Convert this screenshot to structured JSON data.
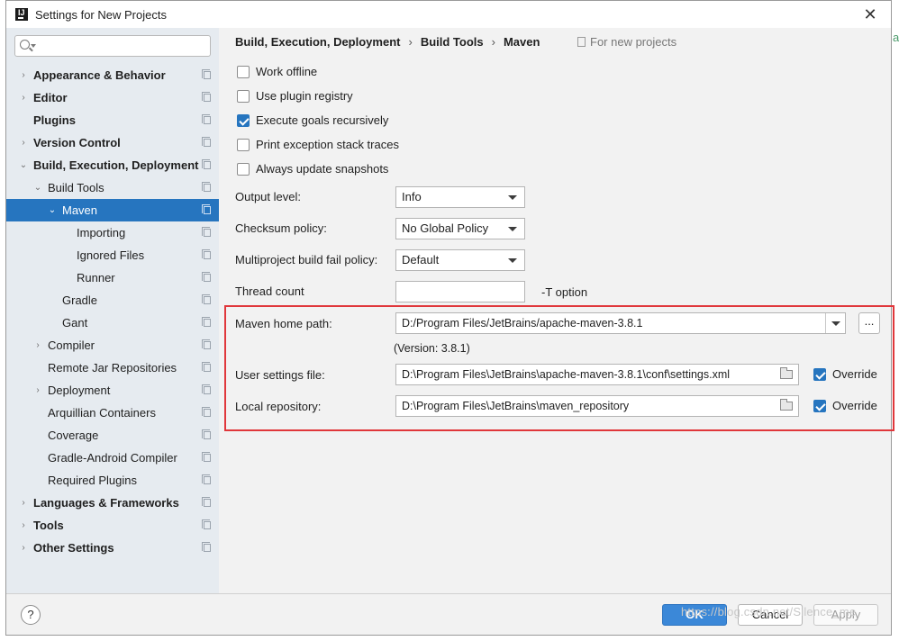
{
  "window": {
    "title": "Settings for New Projects",
    "app_icon_text": "IJ"
  },
  "sidebar": {
    "search_placeholder": "",
    "items": [
      {
        "label": "Appearance & Behavior",
        "level": 0,
        "bold": true,
        "arrow": "›",
        "selected": false
      },
      {
        "label": "Editor",
        "level": 0,
        "bold": true,
        "arrow": "›",
        "selected": false
      },
      {
        "label": "Plugins",
        "level": 0,
        "bold": true,
        "arrow": "",
        "selected": false
      },
      {
        "label": "Version Control",
        "level": 0,
        "bold": true,
        "arrow": "›",
        "selected": false
      },
      {
        "label": "Build, Execution, Deployment",
        "level": 0,
        "bold": true,
        "arrow": "⌄",
        "selected": false
      },
      {
        "label": "Build Tools",
        "level": 1,
        "bold": false,
        "arrow": "⌄",
        "selected": false
      },
      {
        "label": "Maven",
        "level": 2,
        "bold": false,
        "arrow": "⌄",
        "selected": true
      },
      {
        "label": "Importing",
        "level": 3,
        "bold": false,
        "arrow": "",
        "selected": false
      },
      {
        "label": "Ignored Files",
        "level": 3,
        "bold": false,
        "arrow": "",
        "selected": false
      },
      {
        "label": "Runner",
        "level": 3,
        "bold": false,
        "arrow": "",
        "selected": false
      },
      {
        "label": "Gradle",
        "level": 2,
        "bold": false,
        "arrow": "",
        "selected": false
      },
      {
        "label": "Gant",
        "level": 2,
        "bold": false,
        "arrow": "",
        "selected": false
      },
      {
        "label": "Compiler",
        "level": 1,
        "bold": false,
        "arrow": "›",
        "selected": false
      },
      {
        "label": "Remote Jar Repositories",
        "level": 1,
        "bold": false,
        "arrow": "",
        "selected": false
      },
      {
        "label": "Deployment",
        "level": 1,
        "bold": false,
        "arrow": "›",
        "selected": false
      },
      {
        "label": "Arquillian Containers",
        "level": 1,
        "bold": false,
        "arrow": "",
        "selected": false
      },
      {
        "label": "Coverage",
        "level": 1,
        "bold": false,
        "arrow": "",
        "selected": false
      },
      {
        "label": "Gradle-Android Compiler",
        "level": 1,
        "bold": false,
        "arrow": "",
        "selected": false
      },
      {
        "label": "Required Plugins",
        "level": 1,
        "bold": false,
        "arrow": "",
        "selected": false
      },
      {
        "label": "Languages & Frameworks",
        "level": 0,
        "bold": true,
        "arrow": "›",
        "selected": false
      },
      {
        "label": "Tools",
        "level": 0,
        "bold": true,
        "arrow": "›",
        "selected": false
      },
      {
        "label": "Other Settings",
        "level": 0,
        "bold": true,
        "arrow": "›",
        "selected": false
      }
    ]
  },
  "breadcrumb": {
    "items": [
      "Build, Execution, Deployment",
      "Build Tools",
      "Maven"
    ],
    "separator": "›",
    "scope_note": "For new projects"
  },
  "checkboxes": [
    {
      "label": "Work offline",
      "checked": false
    },
    {
      "label": "Use plugin registry",
      "checked": false
    },
    {
      "label": "Execute goals recursively",
      "checked": true
    },
    {
      "label": "Print exception stack traces",
      "checked": false
    },
    {
      "label": "Always update snapshots",
      "checked": false
    }
  ],
  "form": {
    "output_level": {
      "label": "Output level:",
      "value": "Info"
    },
    "checksum_policy": {
      "label": "Checksum policy:",
      "value": "No Global Policy"
    },
    "multiproject_fail_policy": {
      "label": "Multiproject build fail policy:",
      "value": "Default"
    },
    "thread_count": {
      "label": "Thread count",
      "value": "",
      "suffix": "-T option"
    },
    "maven_home": {
      "label": "Maven home path:",
      "value": "D:/Program Files/JetBrains/apache-maven-3.8.1",
      "browse_label": "...",
      "version": "(Version: 3.8.1)"
    },
    "user_settings": {
      "label": "User settings file:",
      "value": "D:\\Program Files\\JetBrains\\apache-maven-3.8.1\\conf\\settings.xml",
      "override_label": "Override",
      "override_checked": true
    },
    "local_repository": {
      "label": "Local repository:",
      "value": "D:\\Program Files\\JetBrains\\maven_repository",
      "override_label": "Override",
      "override_checked": true
    }
  },
  "footer": {
    "help_label": "?",
    "ok_label": "OK",
    "cancel_label": "Cancel",
    "apply_label": "Apply",
    "watermark": "https://blog.csdn.net/Silence_me"
  },
  "edge_fragment": "a",
  "colors": {
    "selection": "#2675bf",
    "highlight_border": "#e0373b",
    "ok_button": "#3b88d8",
    "sidebar_bg": "#e6ebf0"
  }
}
